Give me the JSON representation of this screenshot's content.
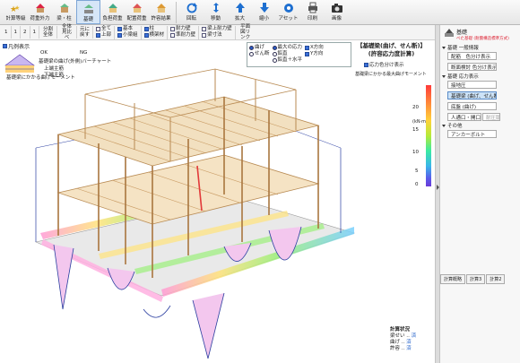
{
  "toolbar": {
    "buttons": [
      {
        "label": "計算等級",
        "icon": "stars-icon"
      },
      {
        "label": "荷重外力",
        "icon": "house-load-icon"
      },
      {
        "label": "梁・柱",
        "icon": "beam-column-icon"
      },
      {
        "label": "基礎",
        "icon": "foundation-icon"
      },
      {
        "label": "負担荷重",
        "icon": "load-share-icon"
      },
      {
        "label": "配置荷重",
        "icon": "placement-load-icon"
      },
      {
        "label": "許容結果",
        "icon": "allowable-result-icon"
      },
      {
        "label": "回転",
        "icon": "rotate-icon"
      },
      {
        "label": "移動",
        "icon": "move-icon"
      },
      {
        "label": "拡大",
        "icon": "zoom-in-icon"
      },
      {
        "label": "縮小",
        "icon": "zoom-out-icon"
      },
      {
        "label": "アセット",
        "icon": "asset-icon"
      },
      {
        "label": "印刷",
        "icon": "print-icon"
      },
      {
        "label": "画像",
        "icon": "camera-icon"
      }
    ]
  },
  "toolbar2": {
    "floor_buttons": [
      "1",
      "1",
      "2",
      "1",
      "2",
      "1"
    ],
    "button_labels": [
      "分割全体",
      "全体見比べ",
      "元に戻す"
    ],
    "checks_col1": [
      {
        "label": "全て",
        "on": false
      },
      {
        "label": "上部",
        "on": true
      }
    ],
    "checks_col2": [
      {
        "label": "基本",
        "on": true
      },
      {
        "label": "小梁組",
        "on": true
      }
    ],
    "checks_col3": [
      {
        "label": "柱",
        "on": true
      },
      {
        "label": "横架材",
        "on": true
      }
    ],
    "checks_col4": [
      {
        "label": "耐力壁",
        "on": false
      },
      {
        "label": "準耐力壁",
        "on": false
      }
    ],
    "checks_col5": [
      {
        "label": "梁上耐力壁",
        "on": false
      },
      {
        "label": "梁寸法",
        "on": false
      }
    ],
    "reset_label": "平面図リンク"
  },
  "legend": {
    "show_label": "凡例表示",
    "ok_label": "OK",
    "ng_label": "NG",
    "line1": "基礎梁の曲げ(外側)バーチャート",
    "line2": "上端主筋",
    "line3": "下端主筋"
  },
  "viewport": {
    "caption": "基礎梁にかかる曲げモーメント",
    "view_opts": {
      "col1": [
        {
          "label": "曲げ",
          "on": true
        },
        {
          "label": "せん断",
          "on": false
        }
      ],
      "col2": [
        {
          "label": "最大の応力",
          "on": true
        },
        {
          "label": "鉛直",
          "on": false
        },
        {
          "label": "鉛直＋水平",
          "on": false
        }
      ],
      "col3": [
        {
          "label": "X方向",
          "on": true
        },
        {
          "label": "Y方向",
          "on": true
        }
      ]
    },
    "result_title_1": "【基礎梁(曲げ、せん断)】",
    "result_title_2": "(許容応力度計算)",
    "stress_check_label": "応力色分け表示",
    "stress_sub": "基礎梁にかかる最大曲げモーメント",
    "unit": "(kN·m)",
    "color_ticks": [
      "20",
      "15",
      "10",
      "5",
      "0"
    ],
    "status_title": "計算状況",
    "status_rows": [
      {
        "label": "梁せい",
        "value": "済"
      },
      {
        "label": "曲げ",
        "value": "済"
      },
      {
        "label": "許容",
        "value": "済"
      }
    ]
  },
  "panel": {
    "title": "基礎",
    "subtitle": "べた基礎 (耐震構造標準方式)",
    "section1": "基礎 一般情報",
    "btn_layout": "配筋　色分け表示",
    "btn_section": "断面検討 色分け表示",
    "section2": "基礎 応力表示",
    "btn_ground": "接地圧",
    "btn_beam": "基礎梁 (曲げ、せん断)",
    "btn_slab": "底盤 (曲げ)",
    "btn_opening": "人通口・開口部",
    "btn_opening_sub": "耐圧版",
    "section3": "その他",
    "btn_anchor": "アンカーボルト",
    "tabs": [
      "計算概略",
      "計算3",
      "計算2"
    ]
  }
}
